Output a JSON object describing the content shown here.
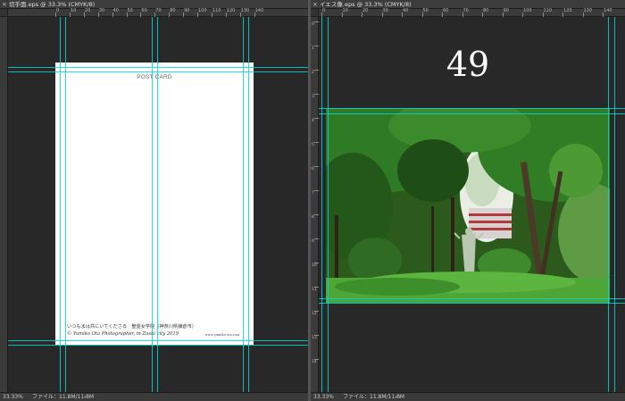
{
  "left_window": {
    "close_glyph": "×",
    "tab_title": "切手面.eps @ 33.3% (CMYK/8)",
    "zoom": "33.33%",
    "file_info": "ファイル：11.8M/11.8M",
    "status_arrow": "›",
    "ruler_h_labels": [
      "0",
      "10",
      "20",
      "30",
      "40",
      "50",
      "60",
      "70",
      "80",
      "90",
      "100",
      "110",
      "120",
      "130",
      "140"
    ],
    "postcard": {
      "title": "POST CARD",
      "message": "いつもまは共にいてくださる　聖霊女学院（神奈川県鎌倉市）",
      "credit": "© Yumiko Ota Photographer, in Zushi city 2019",
      "url": "www.yumiko-ota.com"
    }
  },
  "right_window": {
    "close_glyph": "×",
    "tab_title": "イエス像.eps @ 33.3% (CMYK/8)",
    "zoom": "33.33%",
    "file_info": "ファイル：11.8M/11.8M",
    "status_arrow": "›",
    "ruler_h_labels": [
      "0",
      "10",
      "20",
      "30",
      "40",
      "50",
      "60",
      "70",
      "80",
      "90",
      "100",
      "110",
      "120",
      "130",
      "140"
    ],
    "ruler_v_labels": [
      "0",
      "1",
      "2",
      "3",
      "4",
      "5",
      "6",
      "7",
      "8",
      "9",
      "10",
      "11",
      "12",
      "13",
      "14"
    ],
    "page_number": "49"
  },
  "colors": {
    "workspace": "#282828",
    "ruler": "#3a3a3a",
    "guide": "#00d7d7",
    "canvas": "#ffffff"
  }
}
